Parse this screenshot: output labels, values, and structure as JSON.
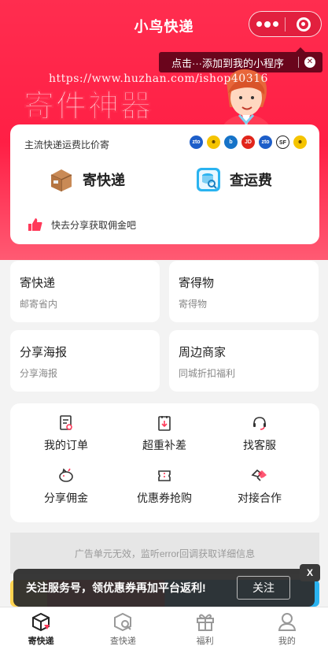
{
  "header": {
    "title": "小鸟快递",
    "add_tip": "点击···添加到我的小程序",
    "watermark": "https://www.huzhan.com/ishop40316",
    "slogan": "寄件神器"
  },
  "main_card": {
    "compare_text": "主流快递运费比价寄",
    "courier_icons": [
      "zto-icon",
      "yunda-icon",
      "best-icon",
      "jd-icon",
      "zto-icon",
      "sf-icon",
      "yunda-icon"
    ],
    "send_label": "寄快递",
    "check_label": "查运费",
    "share_text": "快去分享获取佣金吧"
  },
  "grid": [
    {
      "title": "寄快递",
      "sub": "邮寄省内"
    },
    {
      "title": "寄得物",
      "sub": "寄得物"
    },
    {
      "title": "分享海报",
      "sub": "分享海报"
    },
    {
      "title": "周边商家",
      "sub": "同城折扣福利"
    }
  ],
  "menu": [
    {
      "label": "我的订单",
      "icon": "order-icon"
    },
    {
      "label": "超重补差",
      "icon": "overweight-icon"
    },
    {
      "label": "找客服",
      "icon": "headset-icon"
    },
    {
      "label": "分享佣金",
      "icon": "piggy-bank-icon"
    },
    {
      "label": "优惠券抢购",
      "icon": "coupon-icon"
    },
    {
      "label": "对接合作",
      "icon": "handshake-icon"
    }
  ],
  "ad_text": "广告单元无效，监听error回调获取详细信息",
  "toast": {
    "text": "关注服务号，领优惠券再加平台返利!",
    "follow": "关注",
    "close": "X"
  },
  "tabbar": [
    {
      "label": "寄快递",
      "active": true
    },
    {
      "label": "查快递",
      "active": false
    },
    {
      "label": "福利",
      "active": false
    },
    {
      "label": "我的",
      "active": false
    }
  ],
  "colors": {
    "brand": "#ff2d4f",
    "accent_blue": "#2ab3f0"
  }
}
